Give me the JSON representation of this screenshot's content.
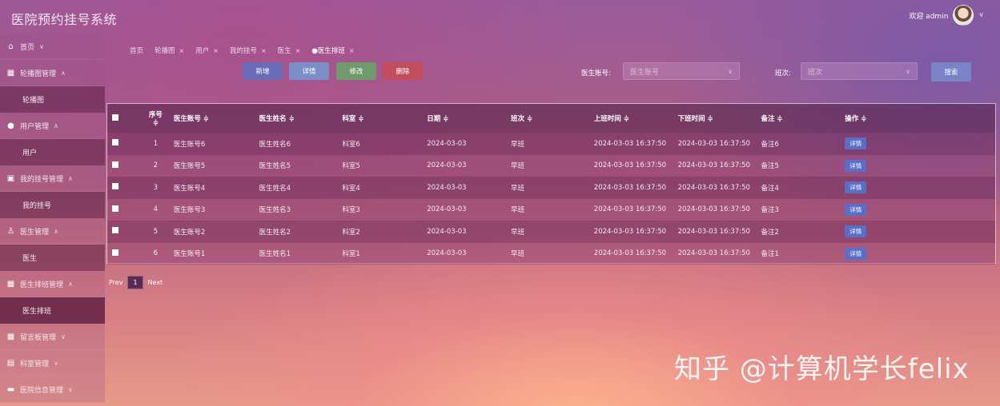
{
  "app": {
    "title": "医院预约挂号系统",
    "welcome": "欢迎 admin"
  },
  "sidebar": {
    "items": [
      {
        "label": "首页",
        "type": "group",
        "icon": "home-icon",
        "arrow": "∨"
      },
      {
        "label": "轮播图管理",
        "type": "group",
        "icon": "grid-icon",
        "arrow": "∧"
      },
      {
        "label": "轮播图",
        "type": "sub"
      },
      {
        "label": "用户管理",
        "type": "group",
        "icon": "user-icon",
        "arrow": "∧"
      },
      {
        "label": "用户",
        "type": "sub"
      },
      {
        "label": "我的挂号管理",
        "type": "group",
        "icon": "ticket-icon",
        "arrow": "∧"
      },
      {
        "label": "我的挂号",
        "type": "sub"
      },
      {
        "label": "医生管理",
        "type": "group",
        "icon": "person-icon",
        "arrow": "∧"
      },
      {
        "label": "医生",
        "type": "sub"
      },
      {
        "label": "医生排班管理",
        "type": "group",
        "icon": "grid-icon",
        "arrow": "∧"
      },
      {
        "label": "医生排班",
        "type": "sub",
        "active": true
      },
      {
        "label": "留言板管理",
        "type": "group",
        "icon": "grid-icon",
        "arrow": "∨"
      },
      {
        "label": "科室管理",
        "type": "group",
        "icon": "building-icon",
        "arrow": "∨"
      },
      {
        "label": "医院信息管理",
        "type": "group",
        "icon": "card-icon",
        "arrow": "∨"
      }
    ]
  },
  "breadcrumb": [
    {
      "label": "首页",
      "closable": false
    },
    {
      "label": "轮播图",
      "closable": true
    },
    {
      "label": "用户",
      "closable": true
    },
    {
      "label": "我的挂号",
      "closable": true
    },
    {
      "label": "医生",
      "closable": true
    },
    {
      "label": "●医生排班",
      "closable": true,
      "active": true
    }
  ],
  "toolbar": {
    "add": "新增",
    "detail": "详情",
    "edit": "修改",
    "delete": "删除",
    "search": "搜索"
  },
  "filters": {
    "doctor_account_label": "医生账号:",
    "doctor_account_placeholder": "医生账号",
    "shift_label": "班次:",
    "shift_placeholder": "班次"
  },
  "table": {
    "headers": [
      "序号",
      "医生账号 ≑",
      "医生姓名 ≑",
      "科室 ≑",
      "日期 ≑",
      "班次 ≑",
      "上班时间 ≑",
      "下班时间 ≑",
      "备注 ≑",
      "操作 ≑"
    ],
    "seq_sort": "≑",
    "action_label": "详情",
    "rows": [
      [
        "1",
        "医生账号6",
        "医生姓名6",
        "科室6",
        "2024-03-03",
        "早班",
        "2024-03-03 16:37:50",
        "2024-03-03 16:37:50",
        "备注6"
      ],
      [
        "2",
        "医生账号5",
        "医生姓名5",
        "科室5",
        "2024-03-03",
        "早班",
        "2024-03-03 16:37:50",
        "2024-03-03 16:37:50",
        "备注5"
      ],
      [
        "3",
        "医生账号4",
        "医生姓名4",
        "科室4",
        "2024-03-03",
        "早班",
        "2024-03-03 16:37:50",
        "2024-03-03 16:37:50",
        "备注4"
      ],
      [
        "4",
        "医生账号3",
        "医生姓名3",
        "科室3",
        "2024-03-03",
        "早班",
        "2024-03-03 16:37:50",
        "2024-03-03 16:37:50",
        "备注3"
      ],
      [
        "5",
        "医生账号2",
        "医生姓名2",
        "科室2",
        "2024-03-03",
        "早班",
        "2024-03-03 16:37:50",
        "2024-03-03 16:37:50",
        "备注2"
      ],
      [
        "6",
        "医生账号1",
        "医生姓名1",
        "科室1",
        "2024-03-03",
        "早班",
        "2024-03-03 16:37:50",
        "2024-03-03 16:37:50",
        "备注1"
      ]
    ]
  },
  "pagination": {
    "prev": "Prev",
    "current": "1",
    "next": "Next"
  },
  "watermark": "知乎 @计算机学长felix"
}
